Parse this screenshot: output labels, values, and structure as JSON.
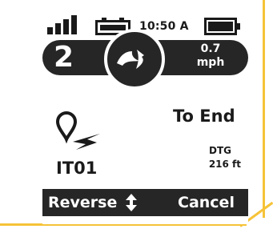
{
  "status": {
    "time": "10:50 A",
    "signal_icon": "signal-bars-icon",
    "satellite_icon": "satellite-battery-icon",
    "battery_icon": "battery-icon"
  },
  "navigation": {
    "left_number": "2",
    "compass_icon": "heading-compass-icon",
    "speed_value": "0.7",
    "speed_unit": "mph"
  },
  "waypoint": {
    "icon": "waypoint-pin-icon",
    "name": "IT01"
  },
  "target": {
    "label": "To End",
    "dtg_label": "DTG",
    "dtg_value": "216 ft"
  },
  "actions": {
    "reverse_label": "Reverse",
    "reverse_icon": "up-down-arrows-icon",
    "cancel_label": "Cancel"
  },
  "colors": {
    "background": "#ffffff",
    "dark": "#262626",
    "frame": "#f6c338"
  }
}
